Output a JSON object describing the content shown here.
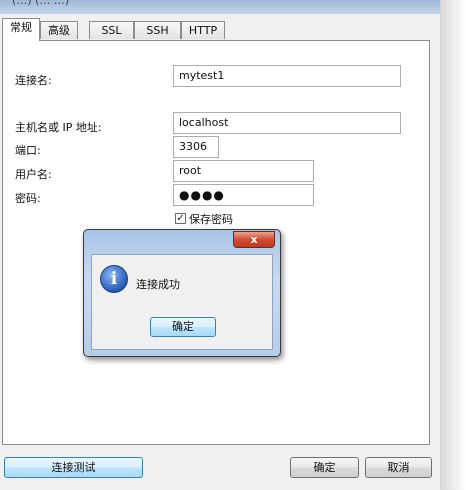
{
  "window": {
    "title_fragment": "(…)  (…  …)"
  },
  "tabs": [
    {
      "label": "常规",
      "active": true
    },
    {
      "label": "高级",
      "active": false
    },
    {
      "label": "SSL",
      "active": false
    },
    {
      "label": "SSH",
      "active": false
    },
    {
      "label": "HTTP",
      "active": false
    }
  ],
  "form": {
    "connection_name_label": "连接名:",
    "connection_name_value": "mytest1",
    "host_label": "主机名或 IP 地址:",
    "host_value": "localhost",
    "port_label": "端口:",
    "port_value": "3306",
    "username_label": "用户名:",
    "username_value": "root",
    "password_label": "密码:",
    "password_mask": "●●●●",
    "save_password_label": "保存密码",
    "save_password_checked": true,
    "checkmark": "✓"
  },
  "dialog": {
    "close_symbol": "x",
    "icon": "info-icon",
    "icon_glyph": "i",
    "message": "连接成功",
    "ok_label": "确定"
  },
  "footer": {
    "test_label": "连接测试",
    "ok_label": "确定",
    "cancel_label": "取消"
  }
}
